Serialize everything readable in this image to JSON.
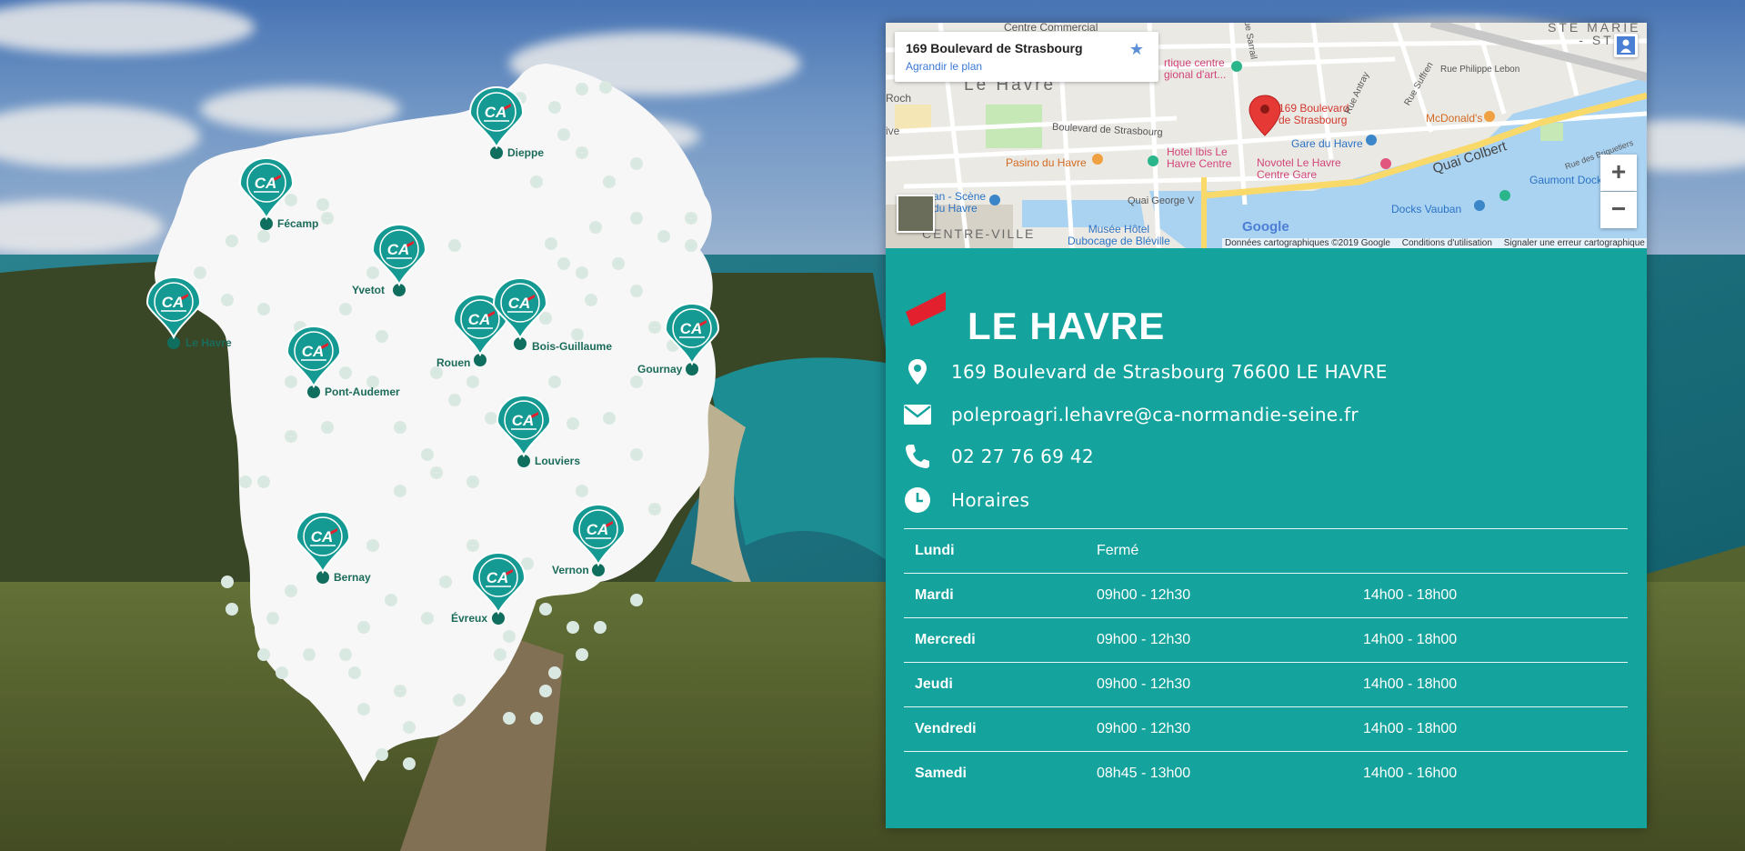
{
  "cities": [
    {
      "id": "dieppe",
      "name": "Dieppe"
    },
    {
      "id": "fecamp",
      "name": "Fécamp"
    },
    {
      "id": "yvetot",
      "name": "Yvetot"
    },
    {
      "id": "le-havre",
      "name": "Le Havre"
    },
    {
      "id": "pont-audemer",
      "name": "Pont-Audemer"
    },
    {
      "id": "rouen",
      "name": "Rouen"
    },
    {
      "id": "bois-guillaume",
      "name": "Bois-Guillaume"
    },
    {
      "id": "gournay",
      "name": "Gournay"
    },
    {
      "id": "louviers",
      "name": "Louviers"
    },
    {
      "id": "bernay",
      "name": "Bernay"
    },
    {
      "id": "vernon",
      "name": "Vernon"
    },
    {
      "id": "evreux",
      "name": "Évreux"
    }
  ],
  "pin_logo_text": "CA",
  "map": {
    "info_title": "169 Boulevard de Strasbourg",
    "info_link": "Agrandir le plan",
    "labels": {
      "le_havre": "Le Havre",
      "centre_ville": "CENTRE-VILLE",
      "marker": "169 Boulevard\nde Strasbourg",
      "blvd1": "Boulevard de Strasbourg",
      "blvd2": "Boulevard de Strasbourg",
      "quai_colbert": "Quai Colbert",
      "quai_george": "Quai George V",
      "gare": "Gare du Havre",
      "mcdo": "McDonald's",
      "novotel": "Novotel Le Havre\nCentre Gare",
      "ibis": "Hotel Ibis Le\nHavre Centre",
      "pasino": "Pasino du Havre",
      "gaumont": "Gaumont Docks Vaub",
      "docks": "Docks Vauban",
      "musee": "Musée Hôtel\nDubocage de Bléville",
      "scene": "an - Scène\ndu Havre",
      "centre_commercial": "Centre Commercial",
      "art": "rtique centre\ngional d'art...",
      "sarrail": "Rue Sarrail",
      "philippe": "Rue Philippe Lebon",
      "ste_marie": "STE MARIE\n- ST LÉ",
      "suffren": "Rue Suffren",
      "briquetiers": "Rue des Briquetiers",
      "aviez": "Rue Antray",
      "roch": "Roch",
      "ive": "ive"
    },
    "google": "Google",
    "attribution": [
      "Données cartographiques ©2019 Google",
      "Conditions d'utilisation",
      "Signaler une erreur cartographique"
    ]
  },
  "agency": {
    "title": "LE HAVRE",
    "address": "169 Boulevard de Strasbourg 76600 LE HAVRE",
    "email": "poleproagri.lehavre@ca-normandie-seine.fr",
    "phone": "02 27 76 69 42",
    "hours_label": "Horaires"
  },
  "hours": [
    {
      "day": "Lundi",
      "am": "Fermé",
      "pm": ""
    },
    {
      "day": "Mardi",
      "am": "09h00 - 12h30",
      "pm": "14h00 - 18h00"
    },
    {
      "day": "Mercredi",
      "am": "09h00 - 12h30",
      "pm": "14h00 - 18h00"
    },
    {
      "day": "Jeudi",
      "am": "09h00 - 12h30",
      "pm": "14h00 - 18h00"
    },
    {
      "day": "Vendredi",
      "am": "09h00 - 12h30",
      "pm": "14h00 - 18h00"
    },
    {
      "day": "Samedi",
      "am": "08h45 - 13h00",
      "pm": "14h00 - 16h00"
    }
  ],
  "colors": {
    "teal": "#14a39d",
    "pin": "#149a92",
    "pin_dark": "#0f6e5d",
    "accent_red": "#e2202e",
    "region_fill": "#f7f7f7",
    "dot": "#d9e9e2"
  }
}
